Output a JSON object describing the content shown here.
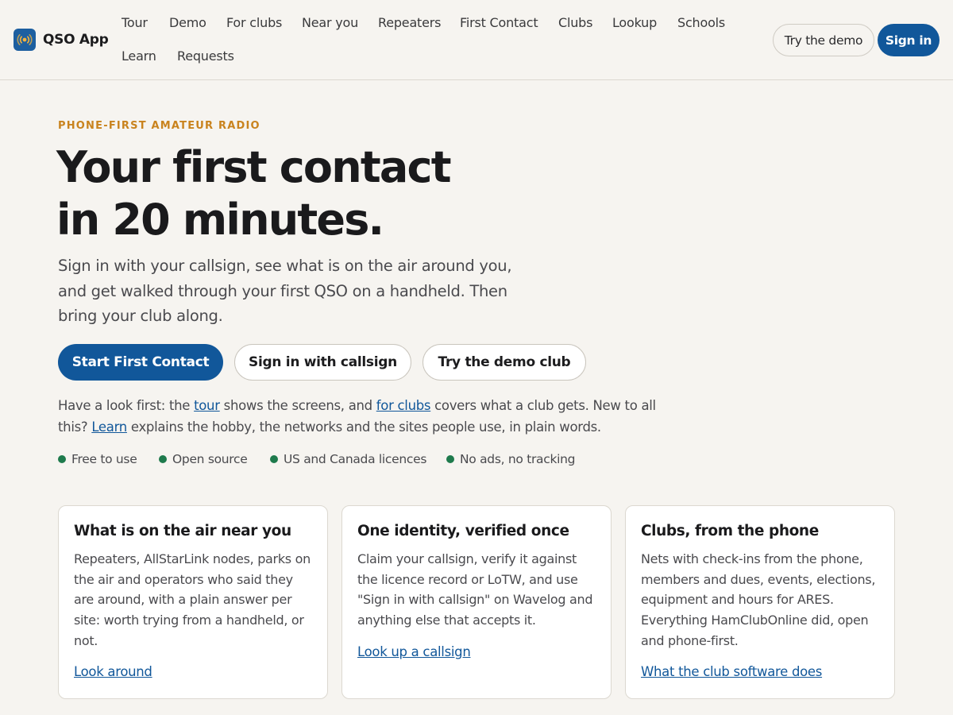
{
  "header": {
    "brand": "QSO App",
    "nav": [
      "Tour",
      "Demo",
      "For clubs",
      "Near you",
      "Repeaters",
      "First Contact",
      "Clubs",
      "Lookup",
      "Schools",
      "Learn",
      "Requests"
    ],
    "try_demo": "Try the demo",
    "sign_in": "Sign in"
  },
  "hero": {
    "eyebrow": "PHONE-FIRST AMATEUR RADIO",
    "headline_line1": "Your first contact",
    "headline_line2": "in 20 minutes.",
    "lede": "Sign in with your callsign, see what is on the air around you, and get walked through your first QSO on a handheld. Then bring your club along.",
    "cta_primary": "Start First Contact",
    "cta_callsign": "Sign in with callsign",
    "cta_demo": "Try the demo club",
    "note": {
      "part1": "Have a look first: the ",
      "link_tour": "tour",
      "part2": " shows the screens, and ",
      "link_clubs": "for clubs",
      "part3": " covers what a club gets. New to all this? ",
      "link_learn": "Learn",
      "part4": " explains the hobby, the networks and the sites people use, in plain words."
    },
    "badges": [
      "Free to use",
      "Open source",
      "US and Canada licences",
      "No ads, no tracking"
    ]
  },
  "cards": [
    {
      "title": "What is on the air near you",
      "body": "Repeaters, AllStarLink nodes, parks on the air and operators who said they are around, with a plain answer per site: worth trying from a handheld, or not.",
      "link": "Look around"
    },
    {
      "title": "One identity, verified once",
      "body": "Claim your callsign, verify it against the licence record or LoTW, and use \"Sign in with callsign\" on Wavelog and anything else that accepts it.",
      "link": "Look up a callsign"
    },
    {
      "title": "Clubs, from the phone",
      "body": "Nets with check-ins from the phone, members and dues, events, elections, equipment and hours for ARES. Everything HamClubOnline did, open and phone-first.",
      "link": "What the club software does"
    }
  ],
  "colors": {
    "background": "#f6f4f0",
    "accent_blue": "#11579a",
    "eyebrow_orange": "#c9831e",
    "badge_green": "#1e7a4c"
  },
  "icons": {
    "brand": "radio-broadcast-icon",
    "badge": "green-dot-icon"
  }
}
